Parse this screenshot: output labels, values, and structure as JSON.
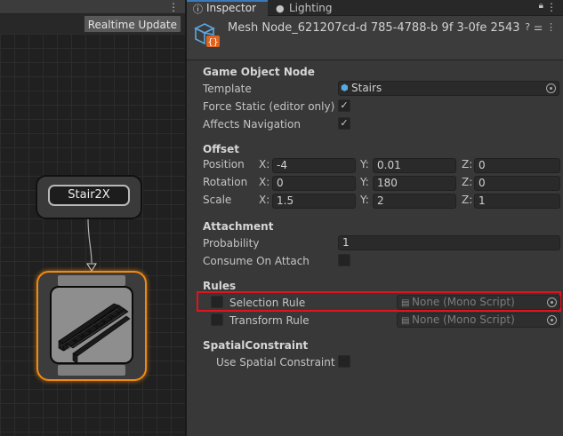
{
  "graph": {
    "toolbar_button": "Realtime Update",
    "nodes": [
      {
        "label": "Stair2X"
      }
    ]
  },
  "tabs": [
    {
      "label": "Inspector",
      "icon": "info-icon",
      "active": true
    },
    {
      "label": "Lighting",
      "icon": "bulb-icon",
      "active": false
    }
  ],
  "header": {
    "title": "Mesh Node_621207cd-d 785-4788-b 9f 3-0fe 2543",
    "icon": "prefab-cube-icon"
  },
  "sections": {
    "game_object_node": {
      "title": "Game Object Node",
      "template_label": "Template",
      "template_value": "Stairs",
      "force_static_label": "Force Static (editor only)",
      "force_static_checked": true,
      "affects_navigation_label": "Affects Navigation",
      "affects_navigation_checked": true
    },
    "offset": {
      "title": "Offset",
      "position": {
        "label": "Position",
        "x": "-4",
        "y": "0.01",
        "z": "0"
      },
      "rotation": {
        "label": "Rotation",
        "x": "0",
        "y": "180",
        "z": "0"
      },
      "scale": {
        "label": "Scale",
        "x": "1.5",
        "y": "2",
        "z": "1"
      },
      "axis_x": "X:",
      "axis_y": "Y:",
      "axis_z": "Z:"
    },
    "attachment": {
      "title": "Attachment",
      "probability_label": "Probability",
      "probability_value": "1",
      "consume_label": "Consume On Attach",
      "consume_checked": false
    },
    "rules": {
      "title": "Rules",
      "selection_rule_label": "Selection Rule",
      "selection_rule_value": "None (Mono Script)",
      "transform_rule_label": "Transform Rule",
      "transform_rule_value": "None (Mono Script)"
    },
    "spatial": {
      "title": "SpatialConstraint",
      "use_label": "Use Spatial Constraint",
      "use_checked": false
    }
  },
  "colors": {
    "node_selected_outline": "#f08a14",
    "highlight_box": "#e0141e",
    "active_tab_accent": "#3a79bb",
    "prefab_icon": "#59a9e0"
  }
}
